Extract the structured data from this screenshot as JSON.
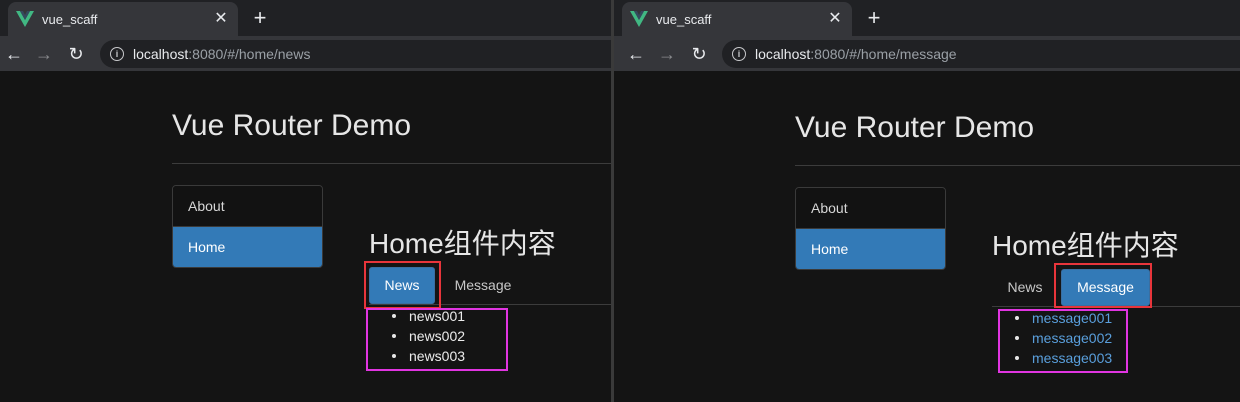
{
  "left": {
    "tab_title": "vue_scaff",
    "url_host": "localhost",
    "url_rest": ":8080/#/home/news",
    "page_header": "Vue Router Demo",
    "nav": [
      {
        "label": "About"
      },
      {
        "label": "Home",
        "active": true
      }
    ],
    "home_title": "Home组件内容",
    "subtabs": [
      {
        "label": "News",
        "active": true
      },
      {
        "label": "Message"
      }
    ],
    "items": [
      "news001",
      "news002",
      "news003"
    ]
  },
  "right": {
    "tab_title": "vue_scaff",
    "url_host": "localhost",
    "url_rest": ":8080/#/home/message",
    "page_header": "Vue Router Demo",
    "nav": [
      {
        "label": "About"
      },
      {
        "label": "Home",
        "active": true
      }
    ],
    "home_title": "Home组件内容",
    "subtabs": [
      {
        "label": "News"
      },
      {
        "label": "Message",
        "active": true
      }
    ],
    "items": [
      "message001",
      "message002",
      "message003"
    ]
  },
  "icons": {
    "favicon": "vue-logo-icon",
    "close": "close-icon",
    "new_tab": "plus-icon",
    "back": "back-arrow-icon",
    "forward": "forward-arrow-icon",
    "reload": "reload-icon",
    "info": "info-icon"
  },
  "symbols": {
    "close": "✕",
    "plus": "+",
    "back": "←",
    "forward": "→",
    "reload": "↻",
    "info": "i"
  },
  "colors": {
    "active_blue": "#337ab7",
    "link_blue": "#5a9fdc",
    "highlight_red": "#e8353b",
    "highlight_magenta": "#e135e1",
    "vue_green": "#41b883"
  }
}
